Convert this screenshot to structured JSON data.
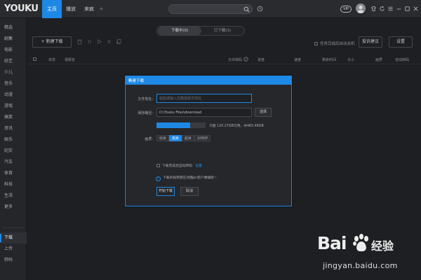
{
  "app": {
    "logo_you": "YOU",
    "logo_ku": "KU"
  },
  "topnav": {
    "tabs": [
      {
        "label": "主页",
        "active": true
      },
      {
        "label": "播放",
        "active": false
      },
      {
        "label": "来疯",
        "active": false
      }
    ],
    "add": "+",
    "search_placeholder": "",
    "vip_badge": "VIP"
  },
  "sidebar": {
    "items": [
      {
        "label": "精选"
      },
      {
        "label": "剧集"
      },
      {
        "label": "电影"
      },
      {
        "label": "综艺"
      },
      {
        "label": "少儿"
      },
      {
        "label": "音乐"
      },
      {
        "label": "动漫"
      },
      {
        "label": "游戏"
      },
      {
        "label": "搞笑"
      },
      {
        "label": "资讯"
      },
      {
        "label": "娱乐"
      },
      {
        "label": "纪实"
      },
      {
        "label": "汽车"
      },
      {
        "label": "体育"
      },
      {
        "label": "科技"
      },
      {
        "label": "生活"
      },
      {
        "label": "更多"
      }
    ],
    "bottom_items": [
      {
        "label": "下载",
        "active": true
      },
      {
        "label": "上传",
        "active": false
      },
      {
        "label": "转码",
        "active": false
      }
    ]
  },
  "downloads": {
    "seg_tabs": [
      {
        "label": "下载中(0)",
        "active": true
      },
      {
        "label": "已下载(3)",
        "active": false
      }
    ],
    "new_button": "+ 新建下载",
    "auto_shutdown_label": "任务完成后自动关机",
    "feedback_button": "投诉建议",
    "settings_button": "设置",
    "columns": [
      "状态",
      "视频名",
      "允许转码",
      "进度",
      "速度",
      "剩余时间",
      "大小",
      "画质",
      "自动转码"
    ]
  },
  "modal": {
    "title": "新建下载",
    "close_glyph": "×",
    "file_url_label": "文件地址:",
    "file_url_placeholder": "粘贴或输入优酷视频页地址",
    "save_path_label": "保存路径:",
    "save_path_value": "D:\\Youku Files\\download",
    "choose_button": "选择",
    "disk_text": "D盘 120.27GB可用，共465.46GB",
    "disk_used_fraction": 0.68,
    "quality_label": "画质:",
    "quality_options": [
      {
        "label": "标清",
        "active": false
      },
      {
        "label": "高清",
        "active": true
      },
      {
        "label": "超清",
        "active": false
      },
      {
        "label": "1080P",
        "active": false
      }
    ],
    "transcode_label": "下载完成后自动转码",
    "transcode_link": "设置",
    "tip_text": "下载的视频需在优酷pc客户端播放~",
    "start_button": "开始下载",
    "cancel_button": "取消"
  },
  "watermark": {
    "brand": "Bai",
    "jingyan": "经验",
    "url": "jingyan.baidu.com"
  },
  "colors": {
    "accent": "#1e88e5",
    "background": "#1e1f22",
    "panel": "#26272b"
  }
}
